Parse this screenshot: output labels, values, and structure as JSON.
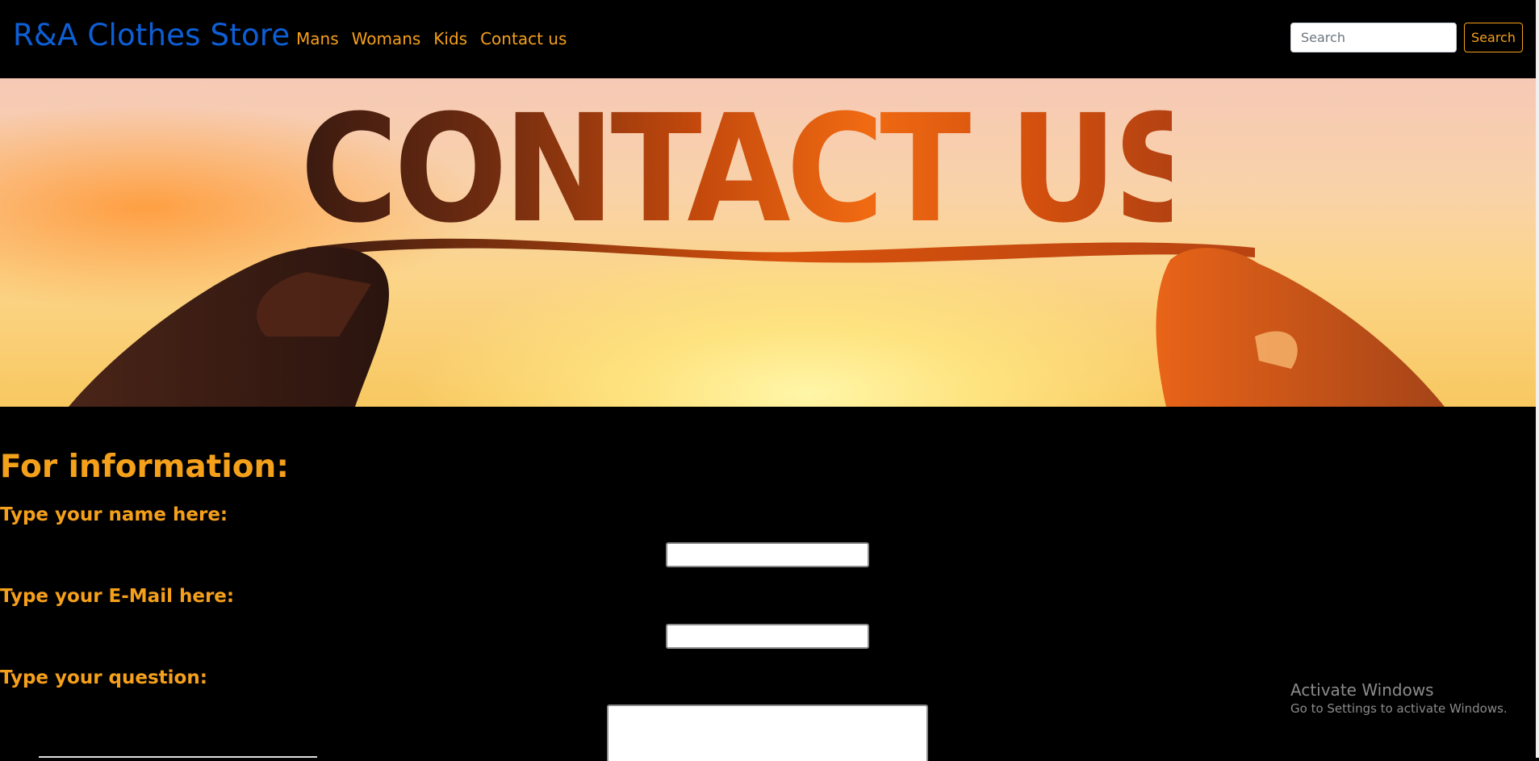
{
  "navbar": {
    "brand": "R&A Clothes Store",
    "links": [
      "Mans",
      "Womans",
      "Kids",
      "Contact us"
    ],
    "search_placeholder": "Search",
    "search_button": "Search"
  },
  "hero": {
    "text": "CONTACT US"
  },
  "form": {
    "title": "For information:",
    "name_label": "Type your name here:",
    "email_label": "Type your E-Mail here:",
    "question_label": "Type your question:"
  },
  "watermark": {
    "title": "Activate Windows",
    "subtitle": "Go to Settings to activate Windows."
  },
  "colors": {
    "accent": "#f5a01a",
    "brand": "#0d5fd6",
    "background": "#000000"
  }
}
